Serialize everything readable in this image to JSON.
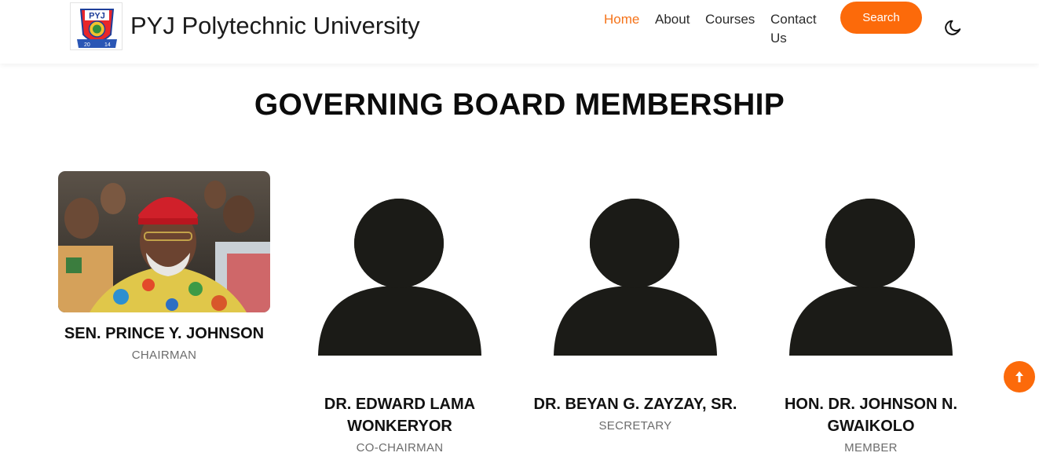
{
  "header": {
    "logo": {
      "icon": "university-crest-logo",
      "text": "PYJ",
      "year_left": "20",
      "year_right": "14"
    },
    "brand_name": "PYJ Polytechnic University",
    "nav": [
      {
        "label": "Home",
        "active": true
      },
      {
        "label": "About",
        "active": false
      },
      {
        "label": "Courses",
        "active": false
      },
      {
        "label": "Contact Us",
        "active": false
      }
    ],
    "search_label": "Search",
    "theme_toggle_icon": "moon-icon"
  },
  "main": {
    "title": "GOVERNING BOARD MEMBERSHIP",
    "members": [
      {
        "name": "SEN. PRINCE Y. JOHNSON",
        "role": "CHAIRMAN",
        "image": "photo"
      },
      {
        "name": "DR. EDWARD LAMA WONKERYOR",
        "role": "CO-CHAIRMAN",
        "image": "user-silhouette-icon"
      },
      {
        "name": "DR. BEYAN G. ZAYZAY, SR.",
        "role": "SECRETARY",
        "image": "user-silhouette-icon"
      },
      {
        "name": "HON. DR. JOHNSON N. GWAIKOLO",
        "role": "MEMBER",
        "image": "user-silhouette-icon"
      }
    ]
  },
  "floating": {
    "back_to_top_icon": "arrow-up-icon"
  },
  "colors": {
    "accent": "#fc6a0a",
    "active_nav": "#f5731a",
    "silhouette": "#1b1b17",
    "role_text": "#6c6c6c"
  }
}
